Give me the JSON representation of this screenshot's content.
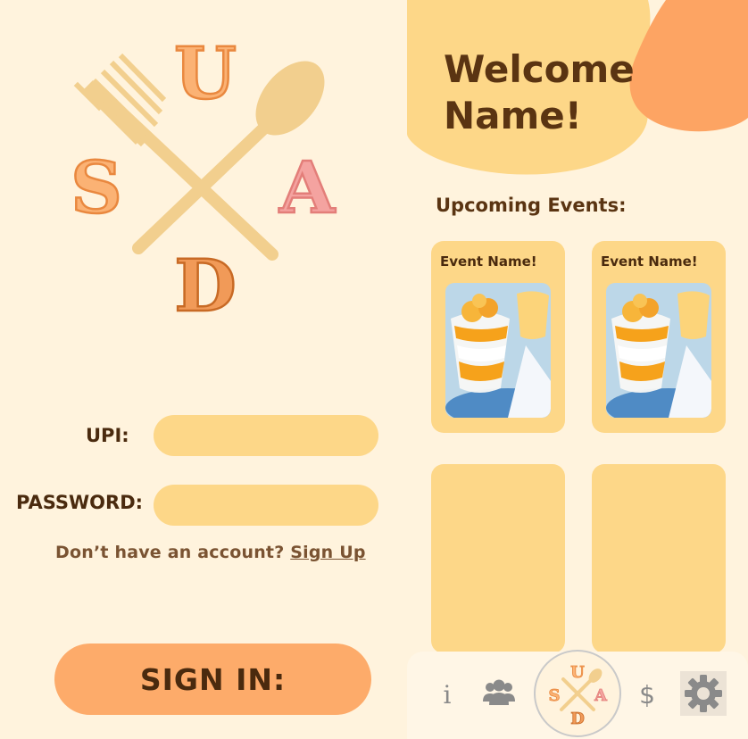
{
  "login": {
    "logo_letters": [
      "S",
      "U",
      "A",
      "D"
    ],
    "upi_label": "UPI:",
    "upi_value": "",
    "password_label": "PASSWORD:",
    "password_value": "",
    "signup_prompt": "Don’t have an account?",
    "signup_link": "Sign Up",
    "signin_button": "SIGN IN:"
  },
  "home": {
    "welcome": "Welcome Name!",
    "upcoming_title": "Upcoming Events:",
    "events": [
      {
        "name": "Event Name!",
        "image": "peach-parfait-dessert"
      },
      {
        "name": "Event Name!",
        "image": "peach-parfait-dessert"
      },
      {
        "name": "",
        "image": ""
      },
      {
        "name": "",
        "image": ""
      }
    ],
    "nav": {
      "info": "i",
      "people": "people-icon",
      "home": "suad-logo-icon",
      "dollar": "$",
      "settings": "gear-icon"
    }
  },
  "colors": {
    "background": "#fff3dd",
    "input": "#fdd788",
    "button": "#fdab6a",
    "text_dark": "#4a2a0e",
    "accent_orange": "#fda463",
    "logo_pink": "#f4a3a0"
  }
}
